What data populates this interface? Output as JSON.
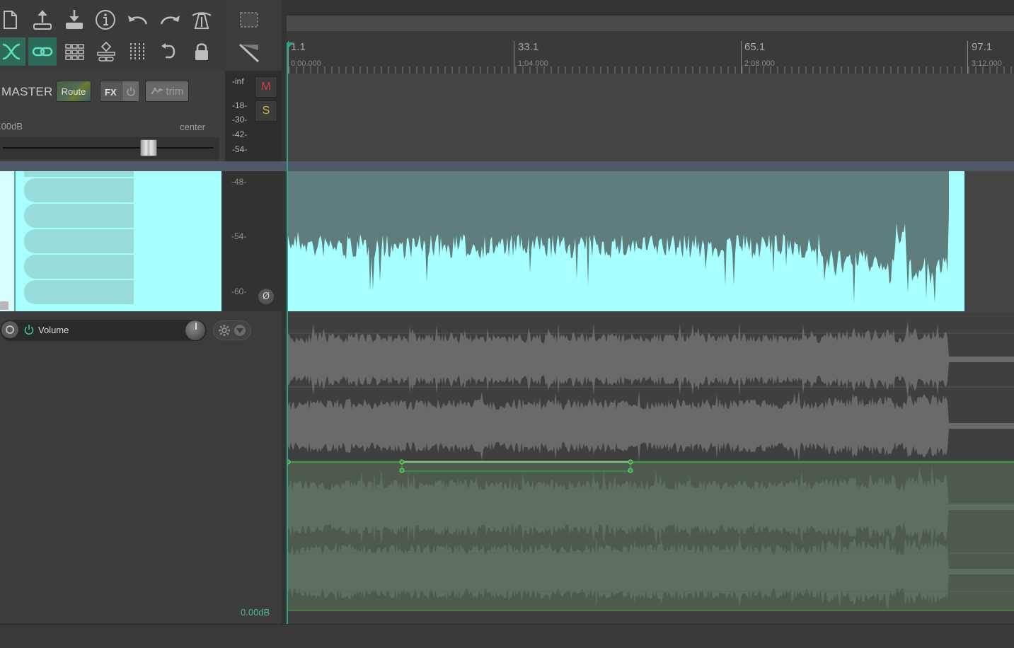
{
  "toolbar": {
    "row1": [
      "new-project-icon",
      "open-project-icon",
      "save-project-icon",
      "project-info-icon",
      "undo-icon",
      "redo-icon",
      "metronome-icon"
    ],
    "row2": [
      "auto-crossfade-icon",
      "ripple-link-icon",
      "grid-icon",
      "item-grouping-icon",
      "snap-icon",
      "loop-icon",
      "lock-icon"
    ]
  },
  "master": {
    "label": "MASTER",
    "route_label": "Route",
    "fx_label": "FX",
    "trim_label": "trim",
    "volume": ".00dB",
    "pan": "center",
    "fader_fraction": 0.69
  },
  "master_meter": {
    "labels": [
      "-inf",
      "-18-",
      "-30-",
      "-42-",
      "-54-"
    ],
    "mute_label": "M",
    "solo_label": "S"
  },
  "track_meter": {
    "labels": [
      "-48-",
      "-54-",
      "-60-"
    ],
    "phase_glyph": "Ø"
  },
  "envelope": {
    "name": "Volume",
    "value": "0.00dB"
  },
  "ruler": {
    "markers": [
      {
        "bar": "1.1",
        "time": "0:00.000"
      },
      {
        "bar": "33.1",
        "time": "1:04.000"
      },
      {
        "bar": "65.1",
        "time": "2:08.000"
      },
      {
        "bar": "97.1",
        "time": "3:12.000"
      }
    ]
  },
  "colors": {
    "accent": "#2fa58f",
    "track_color": "#a8ffff",
    "envelope_green": "#3a9a3a",
    "waveform_gray": "#6a6a6a",
    "waveform_green": "#5f6f5f"
  }
}
